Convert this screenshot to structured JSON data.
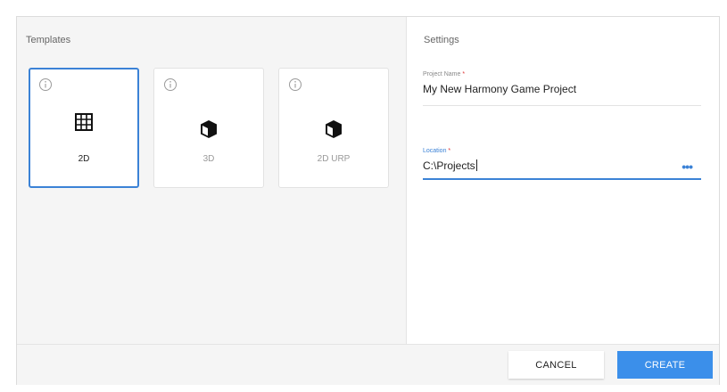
{
  "templates": {
    "title": "Templates",
    "items": [
      {
        "label": "2D",
        "icon": "grid-icon",
        "selected": true
      },
      {
        "label": "3D",
        "icon": "cube-icon",
        "selected": false
      },
      {
        "label": "2D URP",
        "icon": "cube-icon",
        "selected": false
      }
    ]
  },
  "settings": {
    "title": "Settings",
    "project_name": {
      "label": "Project Name",
      "required_mark": "*",
      "value": "My New Harmony Game Project"
    },
    "location": {
      "label": "Location",
      "required_mark": "*",
      "value": "C:\\Projects",
      "browse_label": "•••"
    }
  },
  "footer": {
    "cancel_label": "CANCEL",
    "create_label": "CREATE"
  },
  "colors": {
    "accent": "#3b82d6",
    "create_button": "#3b8fea",
    "panel_bg": "#f5f5f5"
  }
}
